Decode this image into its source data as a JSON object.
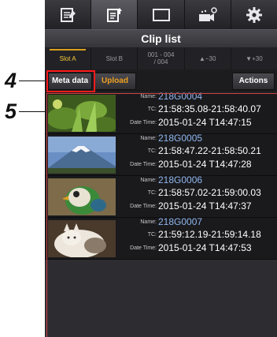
{
  "callouts": {
    "four": "4",
    "five": "5"
  },
  "toolbar": {
    "items": [
      {
        "name": "clip-list-icon"
      },
      {
        "name": "clip-export-icon"
      },
      {
        "name": "display-icon"
      },
      {
        "name": "camera-settings-icon"
      },
      {
        "name": "gear-icon"
      }
    ]
  },
  "title": "Clip list",
  "slots": {
    "slot_a": "Slot A",
    "slot_b": "Slot B",
    "range": "001 - 004\n/ 004",
    "prev": "▲−30",
    "next": "▼+30"
  },
  "actions": {
    "meta_data": "Meta data",
    "upload": "Upload",
    "actions": "Actions"
  },
  "labels": {
    "name": "Name:",
    "tc": "TC:",
    "date_time": "Date Time:"
  },
  "clips": [
    {
      "name": "218G0004",
      "tc": "21:58:35.08-21:58:40.07",
      "date_time": "2015-01-24 T14:47:15",
      "thumb": "plant"
    },
    {
      "name": "218G0005",
      "tc": "21:58:47.22-21:58:50.21",
      "date_time": "2015-01-24 T14:47:28",
      "thumb": "mountain"
    },
    {
      "name": "218G0006",
      "tc": "21:58:57.02-21:59:00.03",
      "date_time": "2015-01-24 T14:47:37",
      "thumb": "bird"
    },
    {
      "name": "218G0007",
      "tc": "21:59:12.19-21:59:14.18",
      "date_time": "2015-01-24 T14:47:53",
      "thumb": "cat"
    }
  ],
  "colors": {
    "accent": "#f0a020",
    "highlight": "#ff1a1a",
    "name_text": "#8fb6ee"
  }
}
